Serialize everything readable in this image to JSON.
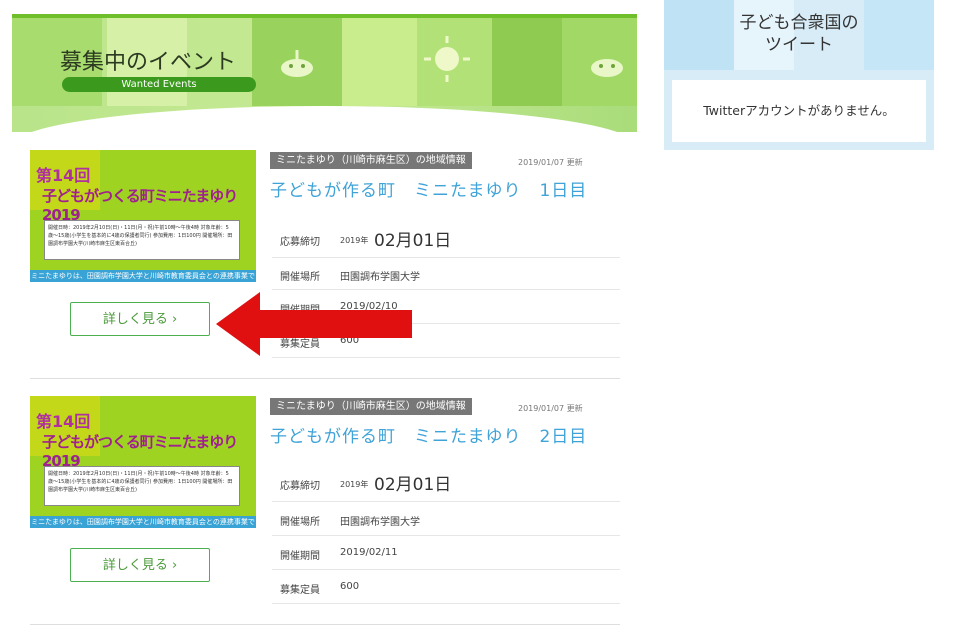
{
  "banner": {
    "title": "募集中のイベント",
    "subtitle": "Wanted Events"
  },
  "twitter_widget": {
    "title": "子ども合衆国の\nツイート",
    "message": "Twitterアカウントがありません。"
  },
  "events": [
    {
      "tag": "ミニたまゆり（川崎市麻生区）の地域情報",
      "updated": "2019/01/07 更新",
      "title": "子どもが作る町　ミニたまゆり　1日目",
      "thumb": {
        "line1": "第14回",
        "line2": "子どもがつくる町ミニたまゆり2019",
        "info": "開催日時：2019年2月10日(日)・11日(月・祝)午前10時〜午後4時\n対象年齢：5歳〜15歳(小学生を基本的に4歳の保護者同行)\n参加費用：1日100円\n開催場所：田園調布学園大学(川崎市麻生区東百合丘)",
        "foot": "ミニたまゆりは、田園調布学園大学と川崎市教育委員会との連携事業です。"
      },
      "more_label": "詳しく見る ›",
      "details": [
        {
          "label": "応募締切",
          "year": "2019年",
          "date": "02月01日"
        },
        {
          "label": "開催場所",
          "value": "田園調布学園大学"
        },
        {
          "label": "開催期間",
          "value": "2019/02/10"
        },
        {
          "label": "募集定員",
          "value": "600"
        }
      ]
    },
    {
      "tag": "ミニたまゆり（川崎市麻生区）の地域情報",
      "updated": "2019/01/07 更新",
      "title": "子どもが作る町　ミニたまゆり　2日目",
      "thumb": {
        "line1": "第14回",
        "line2": "子どもがつくる町ミニたまゆり2019",
        "info": "開催日時：2019年2月10日(日)・11日(月・祝)午前10時〜午後4時\n対象年齢：5歳〜15歳(小学生を基本的に4歳の保護者同行)\n参加費用：1日100円\n開催場所：田園調布学園大学(川崎市麻生区東百合丘)",
        "foot": "ミニたまゆりは、田園調布学園大学と川崎市教育委員会との連携事業です。"
      },
      "more_label": "詳しく見る ›",
      "details": [
        {
          "label": "応募締切",
          "year": "2019年",
          "date": "02月01日"
        },
        {
          "label": "開催場所",
          "value": "田園調布学園大学"
        },
        {
          "label": "開催期間",
          "value": "2019/02/11"
        },
        {
          "label": "募集定員",
          "value": "600"
        }
      ]
    }
  ],
  "colors": {
    "accent_green": "#4caf50",
    "title_blue": "#3fa3d8",
    "arrow_red": "#e01010",
    "widget_blue": "#d7ecf7"
  },
  "icons": {
    "more_chevron": "chevron-right-icon"
  }
}
